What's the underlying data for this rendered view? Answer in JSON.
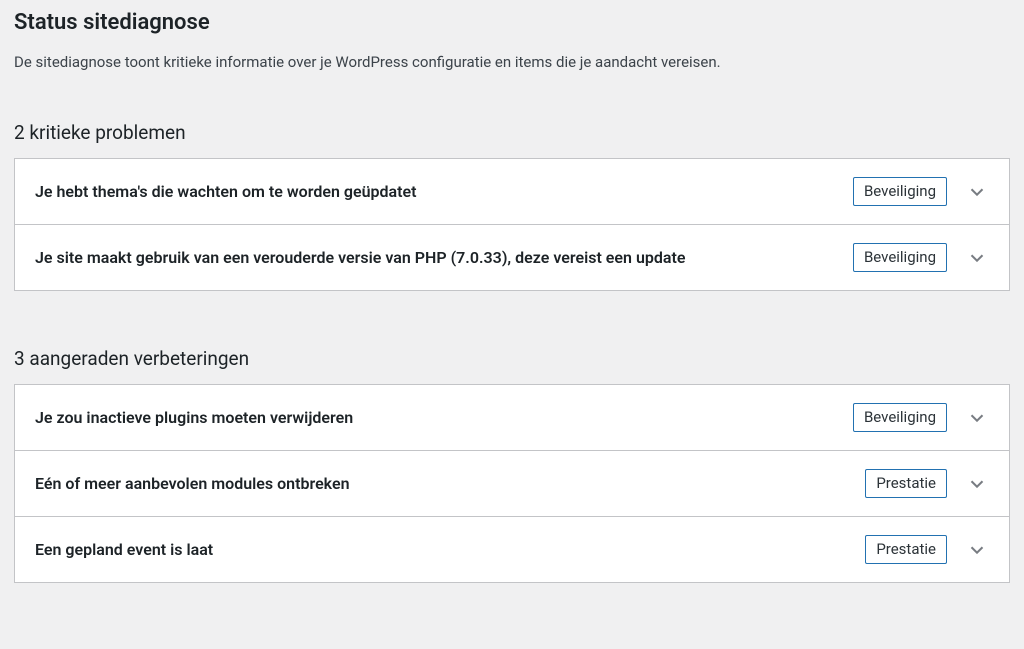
{
  "page": {
    "title": "Status sitediagnose",
    "description": "De sitediagnose toont kritieke informatie over je WordPress configuratie en items die je aandacht vereisen."
  },
  "sections": [
    {
      "heading": "2 kritieke problemen",
      "items": [
        {
          "title": "Je hebt thema's die wachten om te worden geüpdatet",
          "badge": "Beveiliging"
        },
        {
          "title": "Je site maakt gebruik van een verouderde versie van PHP (7.0.33), deze vereist een update",
          "badge": "Beveiliging"
        }
      ]
    },
    {
      "heading": "3 aangeraden verbeteringen",
      "items": [
        {
          "title": "Je zou inactieve plugins moeten verwijderen",
          "badge": "Beveiliging"
        },
        {
          "title": "Eén of meer aanbevolen modules ontbreken",
          "badge": "Prestatie"
        },
        {
          "title": "Een gepland event is laat",
          "badge": "Prestatie"
        }
      ]
    }
  ]
}
